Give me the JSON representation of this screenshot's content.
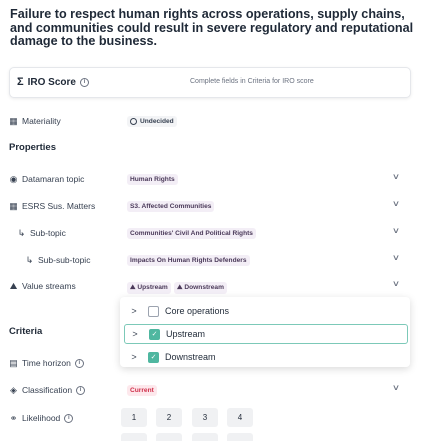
{
  "title": "Failure to respect human rights across operations, supply chains, and communities could result in severe regulatory and reputational damage to the business.",
  "iro_score": {
    "label": "IRO Score",
    "hint": "Complete fields in Criteria for IRO score"
  },
  "materiality": {
    "label": "Materiality",
    "value": "Undecided"
  },
  "properties": {
    "heading": "Properties",
    "datamaran_topic": {
      "label": "Datamaran topic",
      "value": "Human Rights"
    },
    "esrs": {
      "label": "ESRS Sus. Matters",
      "value": "S3. Affected Communities"
    },
    "sub_topic": {
      "label": "Sub-topic",
      "value": "Communities' Civil And Political Rights"
    },
    "sub_sub_topic": {
      "label": "Sub-sub-topic",
      "value": "Impacts On Human Rights Defenders"
    },
    "value_streams": {
      "label": "Value streams",
      "tags": [
        "Upstream",
        "Downstream"
      ]
    }
  },
  "dropdown": {
    "options": [
      {
        "label": "Core operations",
        "checked": false
      },
      {
        "label": "Upstream",
        "checked": true
      },
      {
        "label": "Downstream",
        "checked": true
      }
    ]
  },
  "criteria": {
    "heading": "Criteria",
    "time_horizon": {
      "label": "Time horizon"
    },
    "classification": {
      "label": "Classification",
      "value": "Current"
    },
    "likelihood": {
      "label": "Likelihood",
      "options": [
        "1",
        "2",
        "3",
        "4"
      ]
    }
  },
  "colors": {
    "accent": "#4fb7a0",
    "current": "#d02f4a",
    "tag_bg": "#f3eef6"
  }
}
